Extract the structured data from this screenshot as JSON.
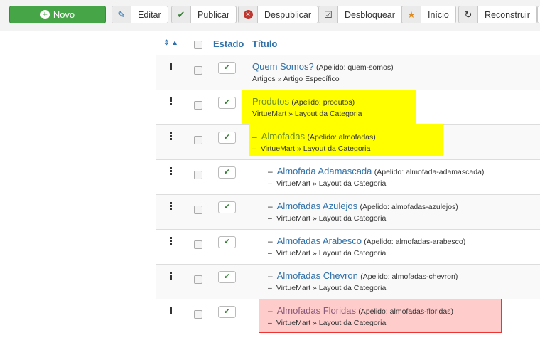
{
  "toolbar": {
    "new": "Novo",
    "edit": "Editar",
    "publish": "Publicar",
    "unpublish": "Despublicar",
    "unlock": "Desbloquear",
    "home": "Início",
    "rebuild": "Reconstruir"
  },
  "table": {
    "headers": {
      "status": "Estado",
      "title": "Título"
    },
    "rows": [
      {
        "title": "Quem Somos?",
        "alias": "(Apelido: quem-somos)",
        "path": "Artigos » Artigo Específico",
        "level": 0,
        "highlight": "none"
      },
      {
        "title": "Produtos",
        "alias": "(Apelido: produtos)",
        "path": "VirtueMart » Layout da Categoria",
        "level": 0,
        "highlight": "yellow"
      },
      {
        "title": "Almofadas",
        "alias": "(Apelido: almofadas)",
        "path": "VirtueMart » Layout da Categoria",
        "level": 1,
        "highlight": "yellow"
      },
      {
        "title": "Almofada Adamascada",
        "alias": "(Apelido: almofada-adamascada)",
        "path": "VirtueMart » Layout da Categoria",
        "level": 2,
        "highlight": "none"
      },
      {
        "title": "Almofadas Azulejos",
        "alias": "(Apelido: almofadas-azulejos)",
        "path": "VirtueMart » Layout da Categoria",
        "level": 2,
        "highlight": "none"
      },
      {
        "title": "Almofadas Arabesco",
        "alias": "(Apelido: almofadas-arabesco)",
        "path": "VirtueMart » Layout da Categoria",
        "level": 2,
        "highlight": "none"
      },
      {
        "title": "Almofadas Chevron",
        "alias": "(Apelido: almofadas-chevron)",
        "path": "VirtueMart » Layout da Categoria",
        "level": 2,
        "highlight": "none"
      },
      {
        "title": "Almofadas Floridas",
        "alias": "(Apelido: almofadas-floridas)",
        "path": "VirtueMart » Layout da Categoria",
        "level": 2,
        "highlight": "red"
      }
    ]
  },
  "icons": {
    "dash": "–",
    "check": "✔"
  }
}
